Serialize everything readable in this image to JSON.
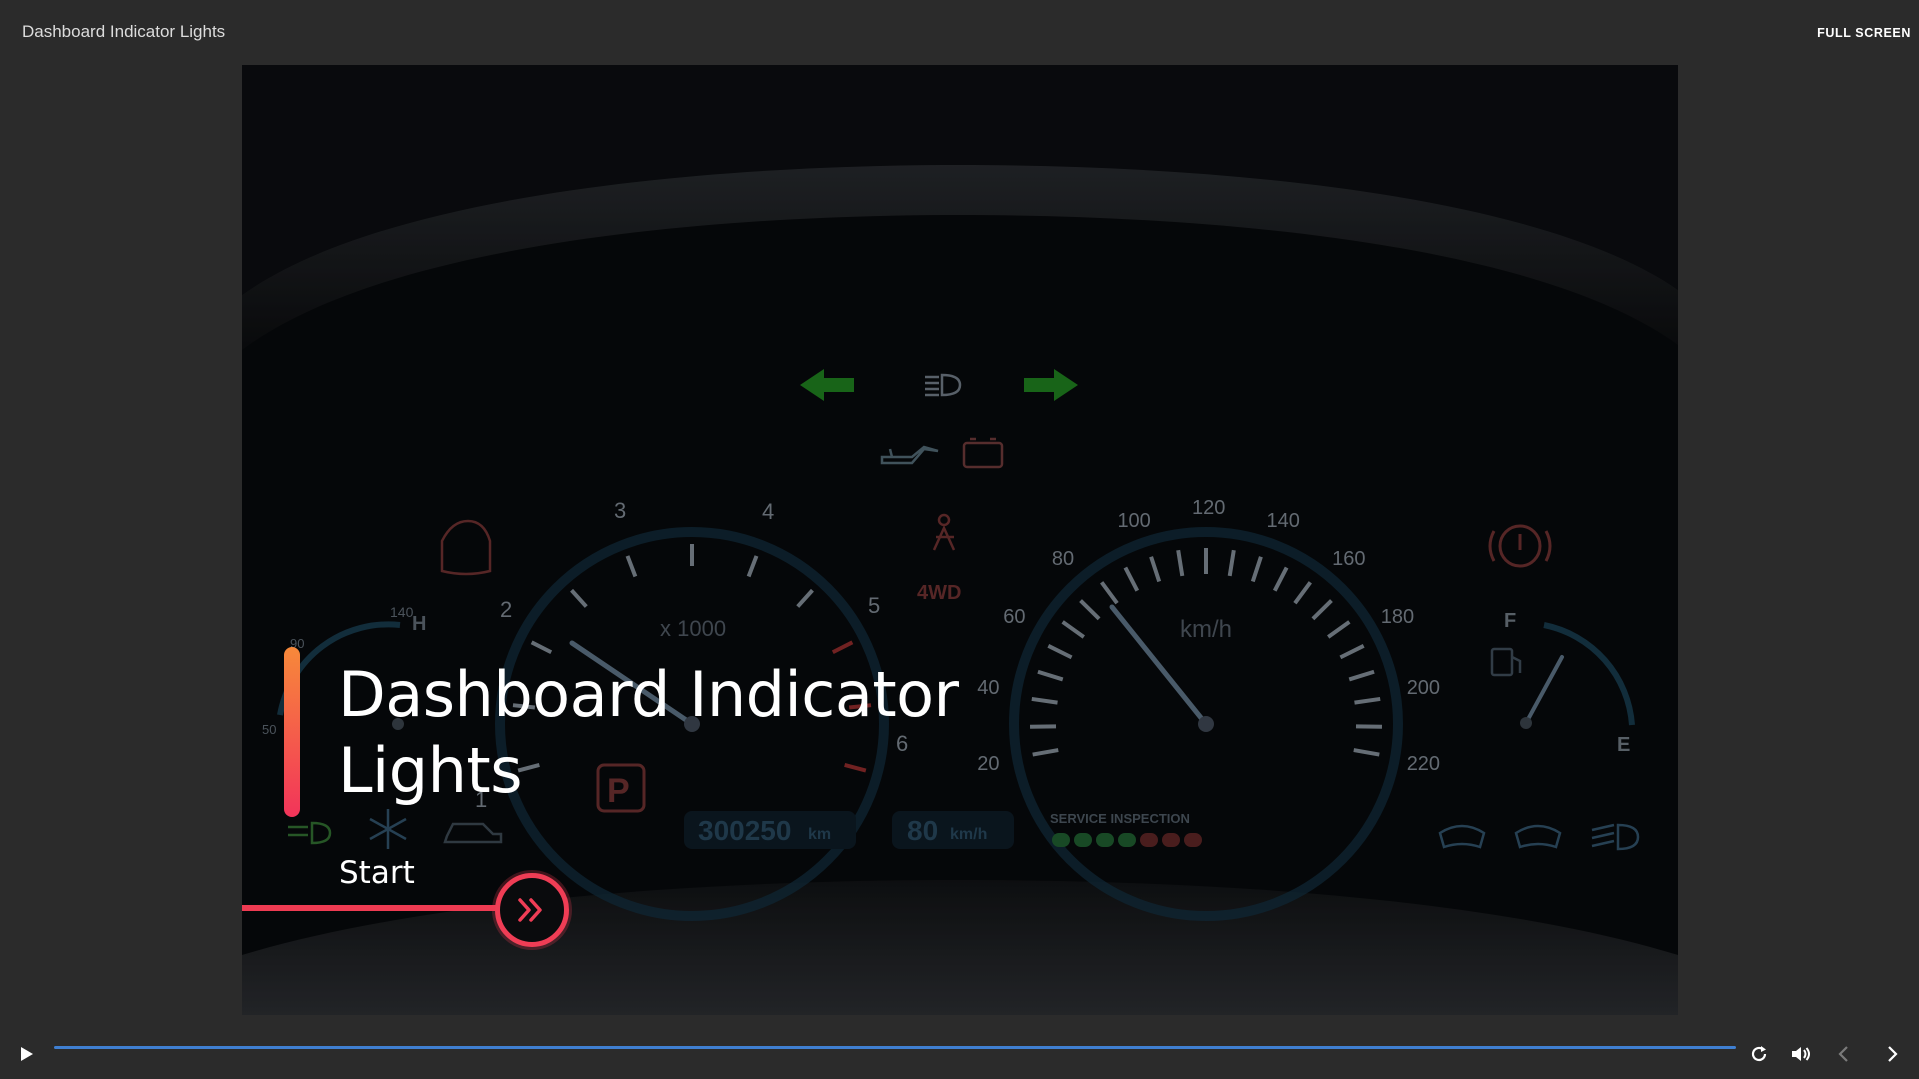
{
  "window": {
    "title": "Dashboard Indicator Lights",
    "fullscreen_label": "FULL SCREEN"
  },
  "slide": {
    "title": "Dashboard Indicator Lights",
    "start_label": "Start"
  },
  "dashboard": {
    "tach_ticks": [
      "1",
      "2",
      "3",
      "4",
      "5",
      "6"
    ],
    "tach_unit": "x 1000",
    "speed_ticks": [
      "20",
      "40",
      "60",
      "80",
      "100",
      "120",
      "140",
      "160",
      "180",
      "200",
      "220"
    ],
    "speed_unit": "km/h",
    "temp_labels": [
      "50",
      "90",
      "140",
      "H"
    ],
    "fuel_labels": [
      "F",
      "E"
    ],
    "odometer": "300250",
    "odometer_unit": "km",
    "cruise_speed": "80",
    "cruise_unit": "km/h",
    "four_wd": "4WD",
    "service_label": "SERVICE INSPECTION",
    "park_label": "P"
  },
  "colors": {
    "accent_orange": "#f7893a",
    "accent_red": "#ef3d55",
    "progress": "#3f7fd1",
    "background": "#2b2b2b"
  },
  "icons": [
    "play-icon",
    "replay-icon",
    "volume-icon",
    "prev-icon",
    "next-icon",
    "fast-forward-icon"
  ]
}
